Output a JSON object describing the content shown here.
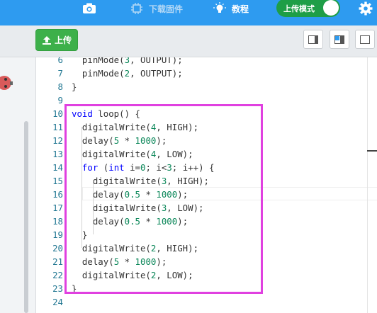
{
  "topbar": {
    "download_firmware_label": "下载固件",
    "tutorial_label": "教程",
    "upload_mode_label": "上传模式",
    "colors": {
      "bar": "#2e9bf0",
      "toggle_on": "#1e9e47"
    }
  },
  "toolbar": {
    "upload_label": "上传",
    "upload_color": "#3db04a"
  },
  "editor": {
    "lines": [
      {
        "n": "6",
        "code": "  pinMode(3, OUTPUT);"
      },
      {
        "n": "7",
        "code": "  pinMode(2, OUTPUT);"
      },
      {
        "n": "8",
        "code": "}"
      },
      {
        "n": "9",
        "code": ""
      },
      {
        "n": "10",
        "code": "void loop() {"
      },
      {
        "n": "11",
        "code": "  digitalWrite(4, HIGH);"
      },
      {
        "n": "12",
        "code": "  delay(5 * 1000);"
      },
      {
        "n": "13",
        "code": "  digitalWrite(4, LOW);"
      },
      {
        "n": "14",
        "code": "  for (int i=0; i<3; i++) {"
      },
      {
        "n": "15",
        "code": "    digitalWrite(3, HIGH);"
      },
      {
        "n": "16",
        "code": "    delay(0.5 * 1000);"
      },
      {
        "n": "17",
        "code": "    digitalWrite(3, LOW);"
      },
      {
        "n": "18",
        "code": "    delay(0.5 * 1000);"
      },
      {
        "n": "19",
        "code": "  }"
      },
      {
        "n": "20",
        "code": "  digitalWrite(2, HIGH);"
      },
      {
        "n": "21",
        "code": "  delay(5 * 1000);"
      },
      {
        "n": "22",
        "code": "  digitalWrite(2, LOW);"
      },
      {
        "n": "23",
        "code": "}"
      },
      {
        "n": "24",
        "code": ""
      }
    ],
    "keywords": [
      "void",
      "for",
      "int"
    ],
    "highlight_color": "#e040e0"
  }
}
